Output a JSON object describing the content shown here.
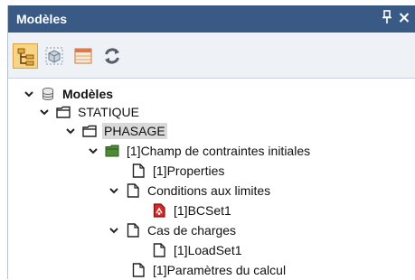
{
  "window": {
    "title": "Modèles",
    "pin_glyph": "📌",
    "close_glyph": "✕"
  },
  "toolbar": {
    "buttons": [
      {
        "name": "tree-view-icon",
        "active": true
      },
      {
        "name": "3d-view-icon",
        "active": false
      },
      {
        "name": "table-view-icon",
        "active": false
      },
      {
        "name": "refresh-icon",
        "active": false
      }
    ]
  },
  "tree": {
    "root": {
      "label": "Modèles",
      "icon": "database-icon"
    },
    "statique": {
      "label": "STATIQUE",
      "icon": "folder-icon"
    },
    "phasage": {
      "label": "PHASAGE",
      "icon": "folder-icon"
    },
    "champ": {
      "label": "[1]Champ de contraintes initiales",
      "icon": "green-folder-icon"
    },
    "properties": {
      "label": "[1]Properties",
      "icon": "document-icon"
    },
    "conditions": {
      "label": "Conditions aux limites",
      "icon": "document-icon"
    },
    "bcset": {
      "label": "[1]BCSet1",
      "icon": "boundary-set-icon"
    },
    "cas": {
      "label": "Cas de charges",
      "icon": "document-icon"
    },
    "loadset": {
      "label": "[1]LoadSet1",
      "icon": "document-icon"
    },
    "parametres": {
      "label": "[1]Paramètres du calcul",
      "icon": "document-icon"
    }
  },
  "colors": {
    "titlebar": "#3a5a86",
    "toolbar_active": "#f8d586",
    "selected_row": "#d9d9d9"
  }
}
